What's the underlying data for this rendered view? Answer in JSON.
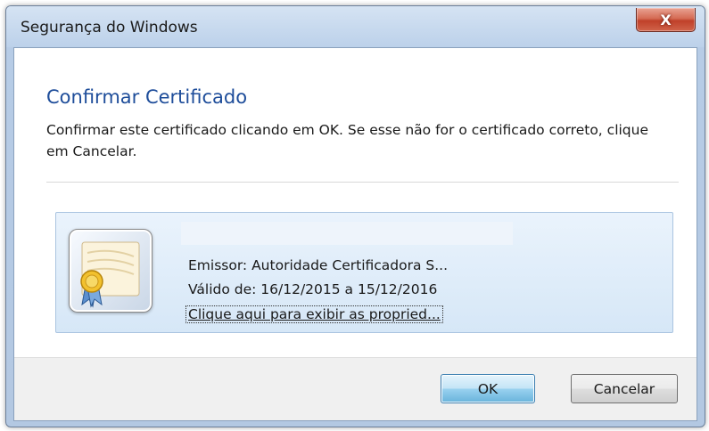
{
  "window": {
    "title": "Segurança do Windows",
    "close_label": "X"
  },
  "dialog": {
    "heading": "Confirmar Certificado",
    "description": "Confirmar este certificado clicando em OK. Se esse não for o certificado correto, clique em Cancelar."
  },
  "certificate": {
    "issuer": "Emissor: Autoridade Certificadora S...",
    "validity": "Válido de: 16/12/2015 a 15/12/2016",
    "properties_link": "Clique aqui para exibir as propried..."
  },
  "buttons": {
    "ok": "OK",
    "cancel": "Cancelar"
  },
  "colors": {
    "heading": "#1e4d9a",
    "close_button": "#c0412a",
    "cert_panel": "#d6e7f7",
    "ok_button": "#98d1ef"
  }
}
